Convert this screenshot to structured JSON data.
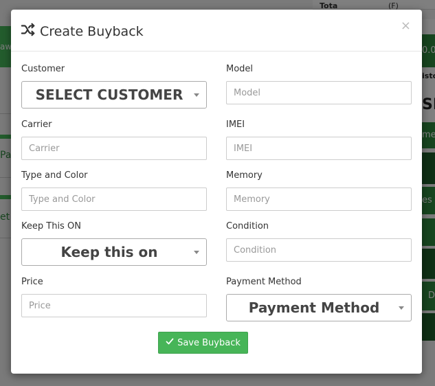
{
  "background": {
    "top_bar_label": "Tota",
    "top_bar_paren": "(F)",
    "left_fragments": [
      "aw",
      "Par",
      "et"
    ],
    "right_fragments": [
      "0.0",
      "isto",
      "SE",
      "me",
      "es V",
      "D"
    ]
  },
  "modal": {
    "title": "Create Buyback",
    "close_symbol": "×",
    "fields": {
      "customer": {
        "label": "Customer",
        "value": "SELECT CUSTOMER"
      },
      "model": {
        "label": "Model",
        "placeholder": "Model"
      },
      "carrier": {
        "label": "Carrier",
        "placeholder": "Carrier"
      },
      "imei": {
        "label": "IMEI",
        "placeholder": "IMEI"
      },
      "type_color": {
        "label": "Type and Color",
        "placeholder": "Type and Color"
      },
      "memory": {
        "label": "Memory",
        "placeholder": "Memory"
      },
      "keep_on": {
        "label": "Keep This ON",
        "value": "Keep this on"
      },
      "condition": {
        "label": "Condition",
        "placeholder": "Condition"
      },
      "price": {
        "label": "Price",
        "placeholder": "Price"
      },
      "payment_method": {
        "label": "Payment Method",
        "value": "Payment Method"
      }
    },
    "save_button": "Save Buyback"
  },
  "colors": {
    "primary_green": "#47b558",
    "dark_green": "#2f8a3f",
    "overlay": "rgba(0,0,0,0.5)"
  },
  "icons": {
    "title_icon": "shuffle-icon",
    "save_icon": "check-icon",
    "select_icon": "caret-down-icon"
  }
}
